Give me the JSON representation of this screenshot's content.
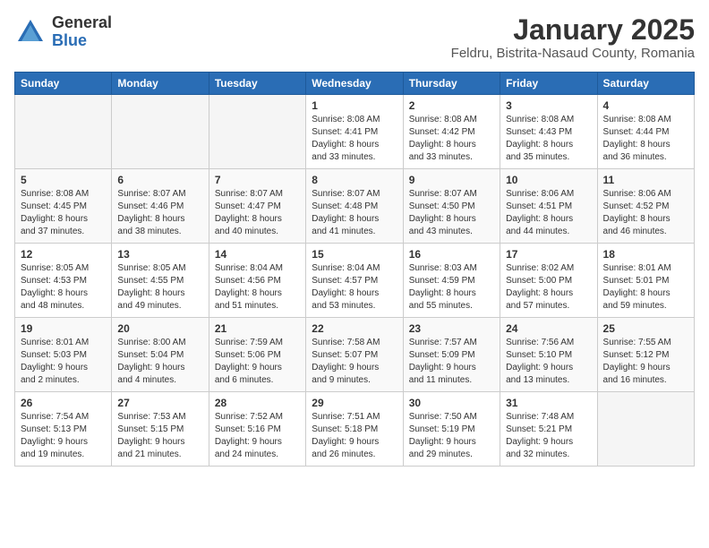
{
  "logo": {
    "general": "General",
    "blue": "Blue"
  },
  "header": {
    "month": "January 2025",
    "location": "Feldru, Bistrita-Nasaud County, Romania"
  },
  "weekdays": [
    "Sunday",
    "Monday",
    "Tuesday",
    "Wednesday",
    "Thursday",
    "Friday",
    "Saturday"
  ],
  "weeks": [
    [
      {
        "day": "",
        "info": ""
      },
      {
        "day": "",
        "info": ""
      },
      {
        "day": "",
        "info": ""
      },
      {
        "day": "1",
        "info": "Sunrise: 8:08 AM\nSunset: 4:41 PM\nDaylight: 8 hours\nand 33 minutes."
      },
      {
        "day": "2",
        "info": "Sunrise: 8:08 AM\nSunset: 4:42 PM\nDaylight: 8 hours\nand 33 minutes."
      },
      {
        "day": "3",
        "info": "Sunrise: 8:08 AM\nSunset: 4:43 PM\nDaylight: 8 hours\nand 35 minutes."
      },
      {
        "day": "4",
        "info": "Sunrise: 8:08 AM\nSunset: 4:44 PM\nDaylight: 8 hours\nand 36 minutes."
      }
    ],
    [
      {
        "day": "5",
        "info": "Sunrise: 8:08 AM\nSunset: 4:45 PM\nDaylight: 8 hours\nand 37 minutes."
      },
      {
        "day": "6",
        "info": "Sunrise: 8:07 AM\nSunset: 4:46 PM\nDaylight: 8 hours\nand 38 minutes."
      },
      {
        "day": "7",
        "info": "Sunrise: 8:07 AM\nSunset: 4:47 PM\nDaylight: 8 hours\nand 40 minutes."
      },
      {
        "day": "8",
        "info": "Sunrise: 8:07 AM\nSunset: 4:48 PM\nDaylight: 8 hours\nand 41 minutes."
      },
      {
        "day": "9",
        "info": "Sunrise: 8:07 AM\nSunset: 4:50 PM\nDaylight: 8 hours\nand 43 minutes."
      },
      {
        "day": "10",
        "info": "Sunrise: 8:06 AM\nSunset: 4:51 PM\nDaylight: 8 hours\nand 44 minutes."
      },
      {
        "day": "11",
        "info": "Sunrise: 8:06 AM\nSunset: 4:52 PM\nDaylight: 8 hours\nand 46 minutes."
      }
    ],
    [
      {
        "day": "12",
        "info": "Sunrise: 8:05 AM\nSunset: 4:53 PM\nDaylight: 8 hours\nand 48 minutes."
      },
      {
        "day": "13",
        "info": "Sunrise: 8:05 AM\nSunset: 4:55 PM\nDaylight: 8 hours\nand 49 minutes."
      },
      {
        "day": "14",
        "info": "Sunrise: 8:04 AM\nSunset: 4:56 PM\nDaylight: 8 hours\nand 51 minutes."
      },
      {
        "day": "15",
        "info": "Sunrise: 8:04 AM\nSunset: 4:57 PM\nDaylight: 8 hours\nand 53 minutes."
      },
      {
        "day": "16",
        "info": "Sunrise: 8:03 AM\nSunset: 4:59 PM\nDaylight: 8 hours\nand 55 minutes."
      },
      {
        "day": "17",
        "info": "Sunrise: 8:02 AM\nSunset: 5:00 PM\nDaylight: 8 hours\nand 57 minutes."
      },
      {
        "day": "18",
        "info": "Sunrise: 8:01 AM\nSunset: 5:01 PM\nDaylight: 8 hours\nand 59 minutes."
      }
    ],
    [
      {
        "day": "19",
        "info": "Sunrise: 8:01 AM\nSunset: 5:03 PM\nDaylight: 9 hours\nand 2 minutes."
      },
      {
        "day": "20",
        "info": "Sunrise: 8:00 AM\nSunset: 5:04 PM\nDaylight: 9 hours\nand 4 minutes."
      },
      {
        "day": "21",
        "info": "Sunrise: 7:59 AM\nSunset: 5:06 PM\nDaylight: 9 hours\nand 6 minutes."
      },
      {
        "day": "22",
        "info": "Sunrise: 7:58 AM\nSunset: 5:07 PM\nDaylight: 9 hours\nand 9 minutes."
      },
      {
        "day": "23",
        "info": "Sunrise: 7:57 AM\nSunset: 5:09 PM\nDaylight: 9 hours\nand 11 minutes."
      },
      {
        "day": "24",
        "info": "Sunrise: 7:56 AM\nSunset: 5:10 PM\nDaylight: 9 hours\nand 13 minutes."
      },
      {
        "day": "25",
        "info": "Sunrise: 7:55 AM\nSunset: 5:12 PM\nDaylight: 9 hours\nand 16 minutes."
      }
    ],
    [
      {
        "day": "26",
        "info": "Sunrise: 7:54 AM\nSunset: 5:13 PM\nDaylight: 9 hours\nand 19 minutes."
      },
      {
        "day": "27",
        "info": "Sunrise: 7:53 AM\nSunset: 5:15 PM\nDaylight: 9 hours\nand 21 minutes."
      },
      {
        "day": "28",
        "info": "Sunrise: 7:52 AM\nSunset: 5:16 PM\nDaylight: 9 hours\nand 24 minutes."
      },
      {
        "day": "29",
        "info": "Sunrise: 7:51 AM\nSunset: 5:18 PM\nDaylight: 9 hours\nand 26 minutes."
      },
      {
        "day": "30",
        "info": "Sunrise: 7:50 AM\nSunset: 5:19 PM\nDaylight: 9 hours\nand 29 minutes."
      },
      {
        "day": "31",
        "info": "Sunrise: 7:48 AM\nSunset: 5:21 PM\nDaylight: 9 hours\nand 32 minutes."
      },
      {
        "day": "",
        "info": ""
      }
    ]
  ]
}
